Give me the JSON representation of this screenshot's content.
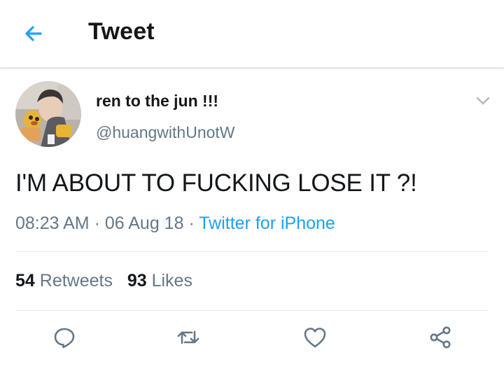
{
  "header": {
    "title": "Tweet",
    "back_icon": "back-arrow-icon",
    "accent": "#1da1f2"
  },
  "tweet": {
    "display_name": "ren to the jun !!!",
    "handle": "@huangwithUnotW",
    "text": "I'M ABOUT TO FUCKING LOSE IT ?!",
    "time": "08:23 AM",
    "date": "06 Aug 18",
    "separator": "·",
    "source": "Twitter for iPhone",
    "retweets_count": "54",
    "retweets_label": "Retweets",
    "likes_count": "93",
    "likes_label": "Likes"
  },
  "actions": [
    {
      "name": "reply",
      "icon": "reply-icon"
    },
    {
      "name": "retweet",
      "icon": "retweet-icon"
    },
    {
      "name": "like",
      "icon": "heart-icon"
    },
    {
      "name": "share",
      "icon": "share-icon"
    }
  ],
  "colors": {
    "text_primary": "#14171a",
    "text_secondary": "#657786",
    "link": "#1da1f2",
    "divider": "#e1e8ed"
  }
}
